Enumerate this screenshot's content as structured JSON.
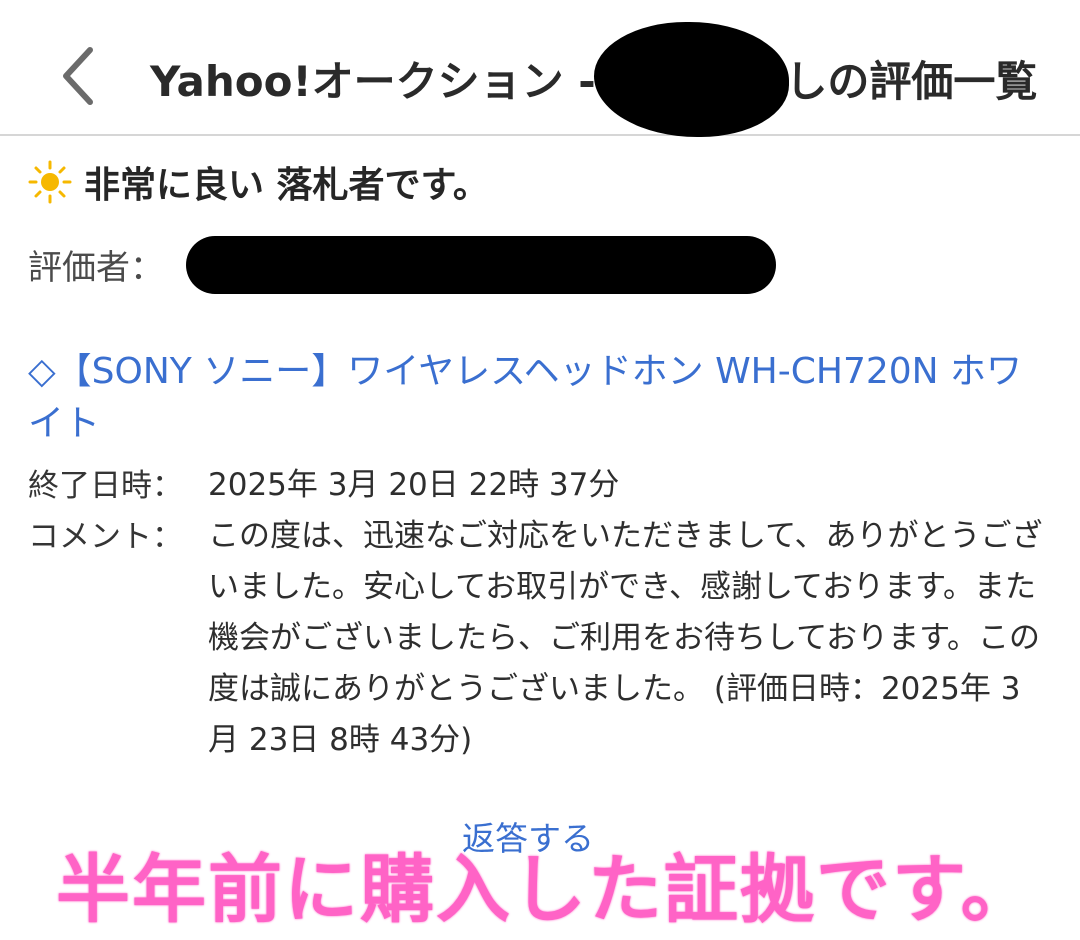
{
  "header": {
    "title": "Yahoo!オークション - ",
    "title_suffix": "しの評価一覧"
  },
  "feedback": {
    "rating": "非常に良い 落札者です。",
    "evaluator_label": "評価者："
  },
  "item": {
    "title": "◇【SONY ソニー】ワイヤレスヘッドホン WH-CH720N ホワイト"
  },
  "details": {
    "end_label": "終了日時：",
    "end_value": "2025年 3月 20日 22時 37分",
    "comment_label": "コメント：",
    "comment_value": "この度は、迅速なご対応をいただきまして、ありがとうございました。安心してお取引ができ、感謝しております。また機会がございましたら、ご利用をお待ちしております。この度は誠にありがとうございました。",
    "comment_date": "(評価日時：2025年 3月 23日 8時 43分)"
  },
  "actions": {
    "reply_label": "返答する"
  },
  "overlay": {
    "caption": "半年前に購入した証拠です。"
  },
  "icons": {
    "back": "chevron-left-icon",
    "rating": "sun-icon"
  },
  "colors": {
    "link": "#3a6fd0",
    "overlay": "#ff63c6",
    "sun": "#f6b800"
  }
}
